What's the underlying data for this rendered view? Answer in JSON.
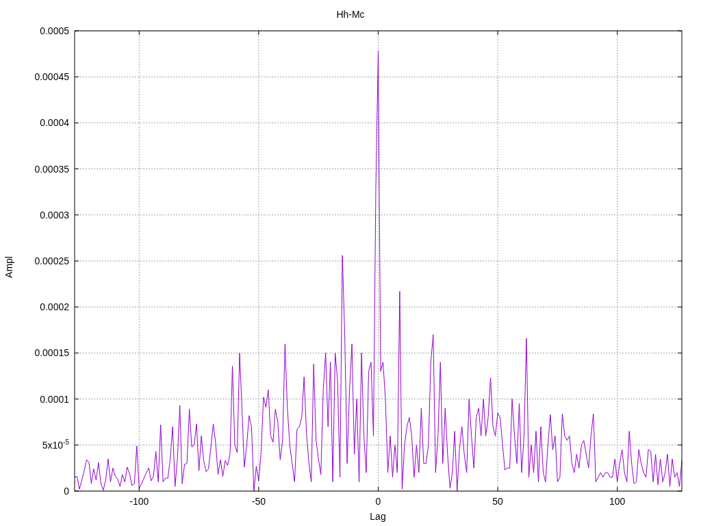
{
  "chart_data": {
    "type": "line",
    "grid": true,
    "title": "Hh-Mc",
    "xlabel": "Lag",
    "ylabel": "Ampl",
    "xlim": [
      -127,
      127
    ],
    "ylim": [
      0,
      0.0005
    ],
    "xticks": [
      -100,
      -50,
      0,
      50,
      100
    ],
    "yticks": [
      0,
      {
        "value": 5e-05,
        "label": "5x10$^{-5}$"
      },
      0.0001,
      0.00015,
      0.0002,
      0.00025,
      0.0003,
      0.00035,
      0.0004,
      0.00045,
      0.0005
    ],
    "x": [
      -127,
      -126,
      -125,
      -124,
      -123,
      -122,
      -121,
      -120,
      -119,
      -118,
      -117,
      -116,
      -115,
      -114,
      -113,
      -112,
      -111,
      -110,
      -109,
      -108,
      -107,
      -106,
      -105,
      -104,
      -103,
      -102,
      -101,
      -100,
      -99,
      -98,
      -97,
      -96,
      -95,
      -94,
      -93,
      -92,
      -91,
      -90,
      -89,
      -88,
      -87,
      -86,
      -85,
      -84,
      -83,
      -82,
      -81,
      -80,
      -79,
      -78,
      -77,
      -76,
      -75,
      -74,
      -73,
      -72,
      -71,
      -70,
      -69,
      -68,
      -67,
      -66,
      -65,
      -64,
      -63,
      -62,
      -61,
      -60,
      -59,
      -58,
      -57,
      -56,
      -55,
      -54,
      -53,
      -52,
      -51,
      -50,
      -49,
      -48,
      -47,
      -46,
      -45,
      -44,
      -43,
      -42,
      -41,
      -40,
      -39,
      -38,
      -37,
      -36,
      -35,
      -34,
      -33,
      -32,
      -31,
      -30,
      -29,
      -28,
      -27,
      -26,
      -25,
      -24,
      -23,
      -22,
      -21,
      -20,
      -19,
      -18,
      -17,
      -16,
      -15,
      -14,
      -13,
      -12,
      -11,
      -10,
      -9,
      -8,
      -7,
      -6,
      -5,
      -4,
      -3,
      -2,
      -1,
      0,
      1,
      2,
      3,
      4,
      5,
      6,
      7,
      8,
      9,
      10,
      11,
      12,
      13,
      14,
      15,
      16,
      17,
      18,
      19,
      20,
      21,
      22,
      23,
      24,
      25,
      26,
      27,
      28,
      29,
      30,
      31,
      32,
      33,
      34,
      35,
      36,
      37,
      38,
      39,
      40,
      41,
      42,
      43,
      44,
      45,
      46,
      47,
      48,
      49,
      50,
      51,
      52,
      53,
      54,
      55,
      56,
      57,
      58,
      59,
      60,
      61,
      62,
      63,
      64,
      65,
      66,
      67,
      68,
      69,
      70,
      71,
      72,
      73,
      74,
      75,
      76,
      77,
      78,
      79,
      80,
      81,
      82,
      83,
      84,
      85,
      86,
      87,
      88,
      89,
      90,
      91,
      92,
      93,
      94,
      95,
      96,
      97,
      98,
      99,
      100,
      101,
      102,
      103,
      104,
      105,
      106,
      107,
      108,
      109,
      110,
      111,
      112,
      113,
      114,
      115,
      116,
      117,
      118,
      119,
      120,
      121,
      122,
      123,
      124,
      125,
      126,
      127
    ],
    "series": [
      {
        "color": "#9400d3",
        "values": [
          1.5e-05,
          1.6e-05,
          2e-06,
          1.2e-05,
          2.2e-05,
          3.4e-05,
          3.1e-05,
          8e-06,
          2.4e-05,
          1.2e-05,
          3.1e-05,
          8e-06,
          1e-06,
          1.2e-05,
          3.5e-05,
          1e-05,
          2.5e-05,
          1.6e-05,
          1.3e-05,
          5e-06,
          1.8e-05,
          1e-05,
          2.6e-05,
          1.9e-05,
          6e-06,
          8e-06,
          4.9e-05,
          3e-06,
          8e-06,
          1.4e-05,
          2e-05,
          2.5e-05,
          1.1e-05,
          1.6e-05,
          4.3e-05,
          1e-05,
          7.2e-05,
          1e-05,
          1.4e-05,
          1.4e-05,
          3.5e-05,
          7e-05,
          5e-06,
          3.5e-05,
          9.3e-05,
          8e-06,
          2.9e-05,
          3e-05,
          8.9e-05,
          4.8e-05,
          5e-05,
          7.3e-05,
          2.2e-05,
          6e-05,
          3.3e-05,
          2.1e-05,
          2.4e-05,
          4.8e-05,
          7.3e-05,
          5.2e-05,
          1.8e-05,
          3.4e-05,
          1.6e-05,
          3.3e-05,
          2.8e-05,
          4e-05,
          0.000136,
          5e-05,
          4.2e-05,
          0.00015,
          9e-05,
          2.6e-05,
          5e-05,
          8.2e-05,
          7e-05,
          0.0,
          2.7e-05,
          1.1e-05,
          4.2e-05,
          0.000102,
          9.1e-05,
          0.00011,
          6e-05,
          5.3e-05,
          8.9e-05,
          7.5e-05,
          3.4e-05,
          5.5e-05,
          0.00016,
          9e-05,
          5e-05,
          3e-05,
          1e-05,
          6.7e-05,
          7e-05,
          8e-05,
          0.000124,
          6.3e-05,
          3.1e-05,
          1e-05,
          0.000138,
          5.5e-05,
          3.5e-05,
          1.8e-05,
          0.00011,
          0.00015,
          7e-05,
          0.00014,
          1e-05,
          0.00015,
          0.00012,
          1.5e-05,
          0.000256,
          0.00017,
          3e-05,
          0.00011,
          0.00016,
          4e-05,
          0.0001,
          1e-05,
          0.00015,
          6e-05,
          2e-05,
          0.00013,
          0.00014,
          6e-05,
          0.00033,
          0.000478,
          0.00013,
          0.00014,
          0.0001,
          2e-05,
          6e-05,
          1.5e-05,
          5e-05,
          2e-05,
          0.000217,
          2e-06,
          5e-05,
          7e-05,
          8e-05,
          6e-05,
          1.5e-05,
          5e-05,
          2e-05,
          9e-05,
          3e-05,
          3e-05,
          5e-05,
          0.00014,
          0.00017,
          2e-05,
          6e-05,
          0.00014,
          3e-05,
          9e-05,
          4e-05,
          3e-06,
          2e-05,
          6.5e-05,
          0.0,
          4.5e-05,
          7e-05,
          4e-05,
          2e-05,
          0.0001,
          6e-05,
          2.5e-05,
          8e-05,
          9e-05,
          6e-05,
          0.0001,
          6e-05,
          8e-05,
          0.000123,
          7e-05,
          6e-05,
          8.5e-05,
          8e-05,
          5e-05,
          2.3e-05,
          2.5e-05,
          2.5e-05,
          0.0001,
          6e-05,
          3e-05,
          9.5e-05,
          2e-05,
          6e-05,
          0.000166,
          1.5e-05,
          5e-05,
          2e-05,
          6.5e-05,
          1e-05,
          7e-05,
          2e-05,
          1e-05,
          5e-05,
          8.3e-05,
          4.5e-05,
          6e-05,
          1e-05,
          1.5e-05,
          8.4e-05,
          6e-05,
          5.5e-05,
          6e-05,
          3e-05,
          2e-05,
          4e-05,
          2.5e-05,
          5e-05,
          5.5e-05,
          4e-05,
          2.5e-05,
          6e-05,
          8.4e-05,
          1e-05,
          1.5e-05,
          2e-05,
          1.5e-05,
          2e-05,
          2e-05,
          1.5e-05,
          1.5e-05,
          3.5e-05,
          1e-05,
          3e-05,
          4.5e-05,
          2e-05,
          1e-05,
          6.5e-05,
          3e-05,
          8e-06,
          1e-05,
          4.5e-05,
          3e-05,
          2e-05,
          1.5e-05,
          4.5e-05,
          4.3e-05,
          1e-05,
          4e-05,
          7e-06,
          3.5e-05,
          1e-05,
          2e-05,
          4e-05,
          5e-06,
          3.5e-05,
          1.5e-05,
          2e-05,
          5e-06,
          3.3e-05
        ]
      }
    ]
  }
}
